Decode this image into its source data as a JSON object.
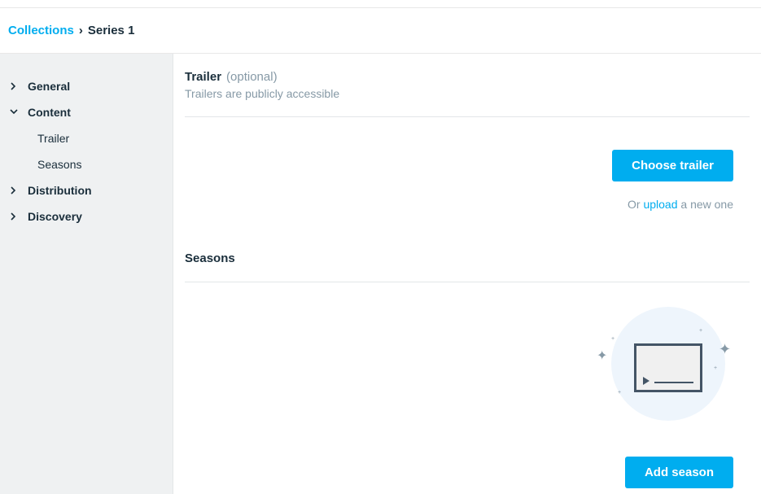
{
  "breadcrumb": {
    "root": "Collections",
    "current": "Series 1"
  },
  "sidebar": {
    "general": "General",
    "content": "Content",
    "trailer": "Trailer",
    "seasons": "Seasons",
    "distribution": "Distribution",
    "discovery": "Discovery"
  },
  "trailer_section": {
    "title": "Trailer",
    "optional": "(optional)",
    "description": "Trailers are publicly accessible",
    "choose_button": "Choose trailer",
    "or_text": "Or ",
    "upload_link": "upload",
    "new_one_text": " a new one"
  },
  "seasons_section": {
    "title": "Seasons",
    "add_button": "Add season"
  }
}
